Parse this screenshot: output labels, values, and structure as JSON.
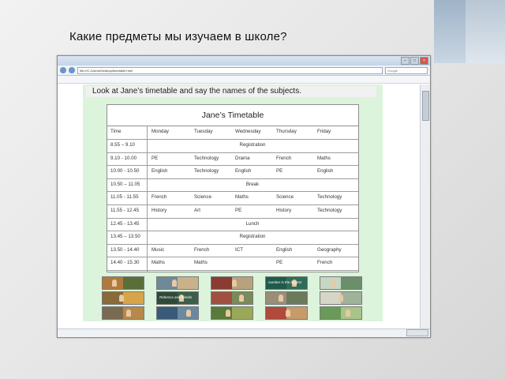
{
  "slide": {
    "title": "Какие предметы мы изучаем в школе?"
  },
  "browser": {
    "url": "file:///C:/Users/Desktop/timetable.html",
    "search_placeholder": "Google"
  },
  "instruction": "Look at Jane’s timetable and say the names of the subjects.",
  "timetable": {
    "title": "Jane’s Timetable",
    "headers": [
      "Time",
      "Monday",
      "Tuesday",
      "Wednesday",
      "Thursday",
      "Friday"
    ],
    "rows": [
      {
        "time": "8.55 – 9.10",
        "merged": "Registration"
      },
      {
        "time": "9.10 - 10.00",
        "cells": [
          "PE",
          "Technology",
          "Drama",
          "French",
          "Maths"
        ]
      },
      {
        "time": "10.00 - 10.50",
        "cells": [
          "English",
          "Technology",
          "English",
          "PE",
          "English"
        ]
      },
      {
        "time": "10.50 – 11.05",
        "merged": "Break"
      },
      {
        "time": "11.05 - 11.55",
        "cells": [
          "French",
          "Science",
          "Maths",
          "Science",
          "Technology"
        ]
      },
      {
        "time": "11.55 - 12.45",
        "cells": [
          "History",
          "Art",
          "PE",
          "History",
          "Technology"
        ]
      },
      {
        "time": "12.45 - 13.45",
        "merged": "Lunch"
      },
      {
        "time": "13.45 – 13.50",
        "merged": "Registration"
      },
      {
        "time": "13.50 - 14.40",
        "cells": [
          "Music",
          "French",
          "ICT",
          "English",
          "Geography"
        ]
      },
      {
        "time": "14.40 - 15.30",
        "cells": [
          "Maths",
          "Maths",
          "",
          "PE",
          "French"
        ]
      }
    ]
  },
  "pictures": [
    {
      "caption": "",
      "c1": "#b07a3c",
      "c2": "#5a6e3a"
    },
    {
      "caption": "",
      "c1": "#6e8a9a",
      "c2": "#c9b28a"
    },
    {
      "caption": "",
      "c1": "#8b3b32",
      "c2": "#b8a27e"
    },
    {
      "caption": "number is the largest",
      "c1": "#1f5a4a",
      "c2": "#2e6e58"
    },
    {
      "caption": "",
      "c1": "#c7d7c4",
      "c2": "#6a8f6a"
    },
    {
      "caption": "",
      "c1": "#8a6a3a",
      "c2": "#d8a44a"
    },
    {
      "caption": "Rebecca and friends",
      "c1": "#2f4a3a",
      "c2": "#3d5e4a"
    },
    {
      "caption": "",
      "c1": "#a05040",
      "c2": "#7a8a5a"
    },
    {
      "caption": "",
      "c1": "#9a8e78",
      "c2": "#6c7a5c"
    },
    {
      "caption": "",
      "c1": "#d6d6c8",
      "c2": "#9fb29a"
    },
    {
      "caption": "",
      "c1": "#7a6a52",
      "c2": "#b8874a"
    },
    {
      "caption": "",
      "c1": "#3a5a7a",
      "c2": "#6a88a0"
    },
    {
      "caption": "",
      "c1": "#5a7a3a",
      "c2": "#9aa85a"
    },
    {
      "caption": "",
      "c1": "#b04a3a",
      "c2": "#c89a6a"
    },
    {
      "caption": "",
      "c1": "#6a9a5a",
      "c2": "#a8c488"
    }
  ]
}
